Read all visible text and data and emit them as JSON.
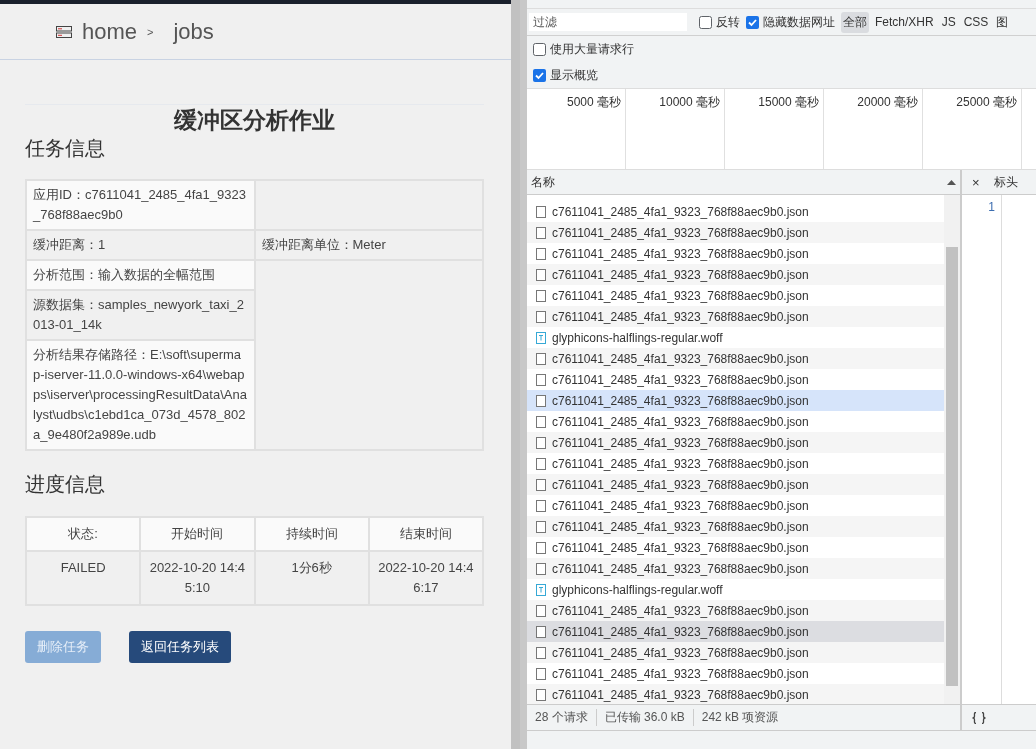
{
  "page": {
    "breadcrumb": [
      {
        "label": "home"
      },
      {
        "label": "jobs"
      }
    ],
    "separator": ">",
    "title": "缓冲区分析作业",
    "task_section": "任务信息",
    "task_info": [
      [
        "应用ID：c7611041_2485_4fa1_9323_768f88aec9b0"
      ],
      [
        "缓冲距离：1",
        "缓冲距离单位：Meter"
      ],
      [
        "分析范围：输入数据的全幅范围"
      ],
      [
        "源数据集：samples_newyork_taxi_2013-01_14k"
      ],
      [
        "分析结果存储路径：E:\\soft\\supermap-iserver-11.0.0-windows-x64\\webapps\\iserver\\processingResultData\\Analyst\\udbs\\c1ebd1ca_073d_4578_802a_9e480f2a989e.udb"
      ]
    ],
    "progress_section": "进度信息",
    "progress_table": {
      "columns": [
        "状态:",
        "开始时间",
        "持续时间",
        "结束时间"
      ],
      "rows": [
        [
          "FAILED",
          "2022-10-20 14:45:10",
          "1分6秒",
          "2022-10-20 14:46:17"
        ]
      ]
    },
    "buttons": [
      {
        "label": "删除任务",
        "disabled": true
      },
      {
        "label": "返回任务列表",
        "disabled": false
      }
    ]
  },
  "devtools": {
    "filter_placeholder": "过滤",
    "options": [
      {
        "label": "反转",
        "checked": false
      },
      {
        "label": "隐藏数据网址",
        "checked": true
      }
    ],
    "types": [
      {
        "label": "全部",
        "selected": true
      },
      {
        "label": "Fetch/XHR",
        "selected": false
      },
      {
        "label": "JS",
        "selected": false
      },
      {
        "label": "CSS",
        "selected": false
      },
      {
        "label": "图",
        "selected": false
      }
    ],
    "settings": [
      {
        "label": "使用大量请求行",
        "checked": false
      },
      {
        "label": "显示概览",
        "checked": true
      }
    ],
    "timeline_ticks": [
      "5000 毫秒",
      "10000 毫秒",
      "15000 毫秒",
      "20000 毫秒",
      "25000 毫秒"
    ],
    "list_header": "名称",
    "requests": [
      {
        "name": "c7611041_2485_4fa1_9323_768f88aec9b0.json",
        "kind": "json",
        "selected": false,
        "hovered": false
      },
      {
        "name": "c7611041_2485_4fa1_9323_768f88aec9b0.json",
        "kind": "json",
        "selected": false,
        "hovered": false
      },
      {
        "name": "c7611041_2485_4fa1_9323_768f88aec9b0.json",
        "kind": "json",
        "selected": false,
        "hovered": false
      },
      {
        "name": "c7611041_2485_4fa1_9323_768f88aec9b0.json",
        "kind": "json",
        "selected": false,
        "hovered": false
      },
      {
        "name": "c7611041_2485_4fa1_9323_768f88aec9b0.json",
        "kind": "json",
        "selected": false,
        "hovered": false
      },
      {
        "name": "c7611041_2485_4fa1_9323_768f88aec9b0.json",
        "kind": "json",
        "selected": false,
        "hovered": false
      },
      {
        "name": "glyphicons-halflings-regular.woff",
        "kind": "font",
        "selected": false,
        "hovered": false
      },
      {
        "name": "c7611041_2485_4fa1_9323_768f88aec9b0.json",
        "kind": "json",
        "selected": false,
        "hovered": false
      },
      {
        "name": "c7611041_2485_4fa1_9323_768f88aec9b0.json",
        "kind": "json",
        "selected": false,
        "hovered": false
      },
      {
        "name": "c7611041_2485_4fa1_9323_768f88aec9b0.json",
        "kind": "json",
        "selected": false,
        "hovered": true
      },
      {
        "name": "c7611041_2485_4fa1_9323_768f88aec9b0.json",
        "kind": "json",
        "selected": false,
        "hovered": false
      },
      {
        "name": "c7611041_2485_4fa1_9323_768f88aec9b0.json",
        "kind": "json",
        "selected": false,
        "hovered": false
      },
      {
        "name": "c7611041_2485_4fa1_9323_768f88aec9b0.json",
        "kind": "json",
        "selected": false,
        "hovered": false
      },
      {
        "name": "c7611041_2485_4fa1_9323_768f88aec9b0.json",
        "kind": "json",
        "selected": false,
        "hovered": false
      },
      {
        "name": "c7611041_2485_4fa1_9323_768f88aec9b0.json",
        "kind": "json",
        "selected": false,
        "hovered": false
      },
      {
        "name": "c7611041_2485_4fa1_9323_768f88aec9b0.json",
        "kind": "json",
        "selected": false,
        "hovered": false
      },
      {
        "name": "c7611041_2485_4fa1_9323_768f88aec9b0.json",
        "kind": "json",
        "selected": false,
        "hovered": false
      },
      {
        "name": "c7611041_2485_4fa1_9323_768f88aec9b0.json",
        "kind": "json",
        "selected": false,
        "hovered": false
      },
      {
        "name": "glyphicons-halflings-regular.woff",
        "kind": "font",
        "selected": false,
        "hovered": false
      },
      {
        "name": "c7611041_2485_4fa1_9323_768f88aec9b0.json",
        "kind": "json",
        "selected": false,
        "hovered": false
      },
      {
        "name": "c7611041_2485_4fa1_9323_768f88aec9b0.json",
        "kind": "json",
        "selected": true,
        "hovered": false
      },
      {
        "name": "c7611041_2485_4fa1_9323_768f88aec9b0.json",
        "kind": "json",
        "selected": false,
        "hovered": false
      },
      {
        "name": "c7611041_2485_4fa1_9323_768f88aec9b0.json",
        "kind": "json",
        "selected": false,
        "hovered": false
      },
      {
        "name": "c7611041_2485_4fa1_9323_768f88aec9b0.json",
        "kind": "json",
        "selected": false,
        "hovered": false
      }
    ],
    "close_glyph": "×",
    "detail_tabs": [
      {
        "label": "标头"
      }
    ],
    "line_number": "1",
    "status": [
      "28 个请求",
      "已传输 36.0 kB",
      "242 kB 项资源"
    ]
  }
}
